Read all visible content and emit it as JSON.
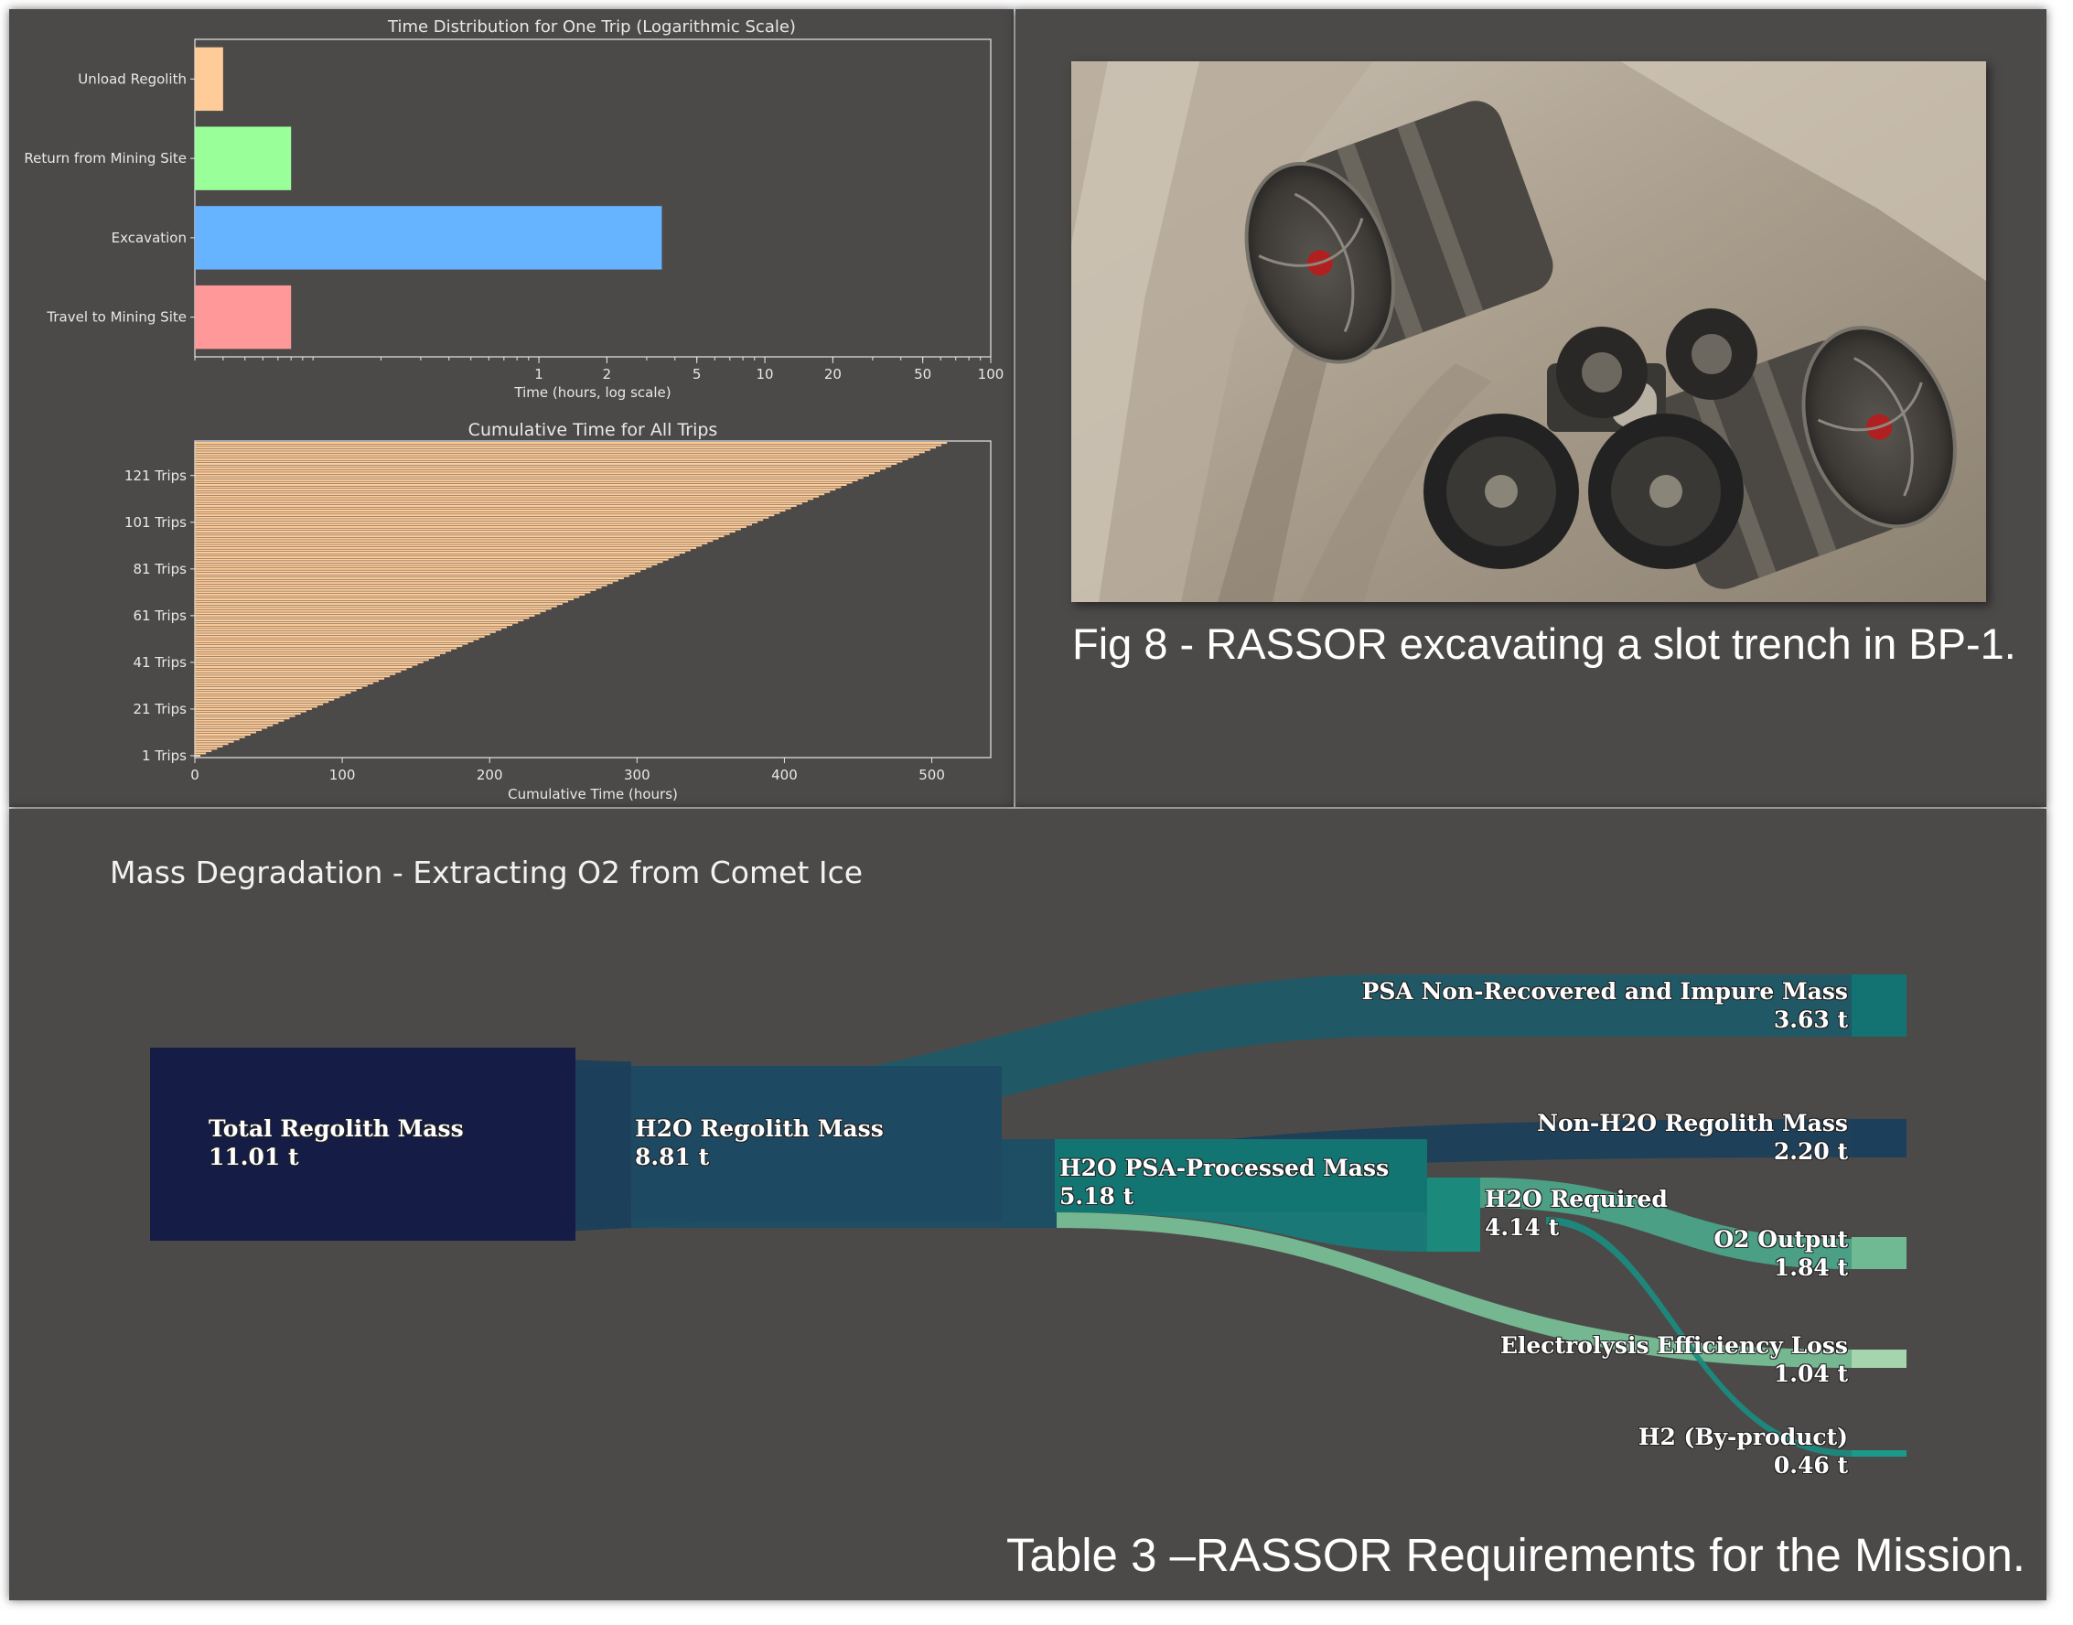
{
  "chart_data": [
    {
      "type": "bar",
      "orientation": "horizontal",
      "title": "Time Distribution for One Trip (Logarithmic Scale)",
      "xlabel": "Time (hours, log scale)",
      "ylabel": "",
      "xscale": "log",
      "xlim": [
        0.03,
        100
      ],
      "xticks": [
        "1",
        "2",
        "5",
        "10",
        "20",
        "50",
        "100"
      ],
      "xtick_values": [
        1,
        2,
        5,
        10,
        20,
        50,
        100
      ],
      "categories": [
        "Travel to Mining Site",
        "Excavation",
        "Return from Mining Site",
        "Unload Regolith"
      ],
      "values": [
        0.08,
        3.5,
        0.08,
        0.04
      ],
      "colors": [
        "#ff9999",
        "#66b3ff",
        "#99ff99",
        "#ffcc99"
      ]
    },
    {
      "type": "bar",
      "orientation": "horizontal",
      "title": "Cumulative Time for All Trips",
      "xlabel": "Cumulative Time (hours)",
      "ylabel": "",
      "xlim": [
        0,
        540
      ],
      "xticks": [
        "0",
        "100",
        "200",
        "300",
        "400",
        "500"
      ],
      "xtick_values": [
        0,
        100,
        200,
        300,
        400,
        500
      ],
      "yticks": [
        "1 Trips",
        "21 Trips",
        "41 Trips",
        "61 Trips",
        "81 Trips",
        "101 Trips",
        "121 Trips"
      ],
      "ytick_trips": [
        1,
        21,
        41,
        61,
        81,
        101,
        121
      ],
      "trip_count": 135,
      "hours_per_trip": 3.78,
      "bar_color": "#ffcc99"
    },
    {
      "type": "sankey",
      "title": "Mass Degradation - Extracting O2 from Comet Ice",
      "unit": "t",
      "nodes": [
        {
          "name": "Total Regolith Mass",
          "value": "11.01 t"
        },
        {
          "name": "H2O Regolith Mass",
          "value": "8.81 t"
        },
        {
          "name": "H2O PSA-Processed Mass",
          "value": "5.18 t"
        },
        {
          "name": "H2O Required",
          "value": "4.14 t"
        },
        {
          "name": "PSA Non-Recovered and Impure Mass",
          "value": "3.63 t"
        },
        {
          "name": "Non-H2O Regolith Mass",
          "value": "2.20 t"
        },
        {
          "name": "O2 Output",
          "value": "1.84 t"
        },
        {
          "name": "Electrolysis Efficiency Loss",
          "value": "1.04 t"
        },
        {
          "name": "H2 (By-product)",
          "value": "0.46 t"
        }
      ],
      "links": [
        {
          "source": "Total Regolith Mass",
          "target": "H2O Regolith Mass",
          "value": 8.81
        },
        {
          "source": "Total Regolith Mass",
          "target": "Non-H2O Regolith Mass",
          "value": 2.2
        },
        {
          "source": "H2O Regolith Mass",
          "target": "PSA Non-Recovered and Impure Mass",
          "value": 3.63
        },
        {
          "source": "H2O Regolith Mass",
          "target": "H2O PSA-Processed Mass",
          "value": 5.18
        },
        {
          "source": "H2O PSA-Processed Mass",
          "target": "H2O Required",
          "value": 4.14
        },
        {
          "source": "H2O PSA-Processed Mass",
          "target": "Electrolysis Efficiency Loss",
          "value": 1.04
        },
        {
          "source": "H2O Required",
          "target": "O2 Output",
          "value": 1.84
        },
        {
          "source": "H2O Required",
          "target": "H2 (By-product)",
          "value": 0.46
        }
      ]
    }
  ],
  "figure_caption": "Fig 8 - RASSOR excavating a slot trench in BP-1.",
  "table_caption": "Table 3 –RASSOR Requirements for the Mission."
}
